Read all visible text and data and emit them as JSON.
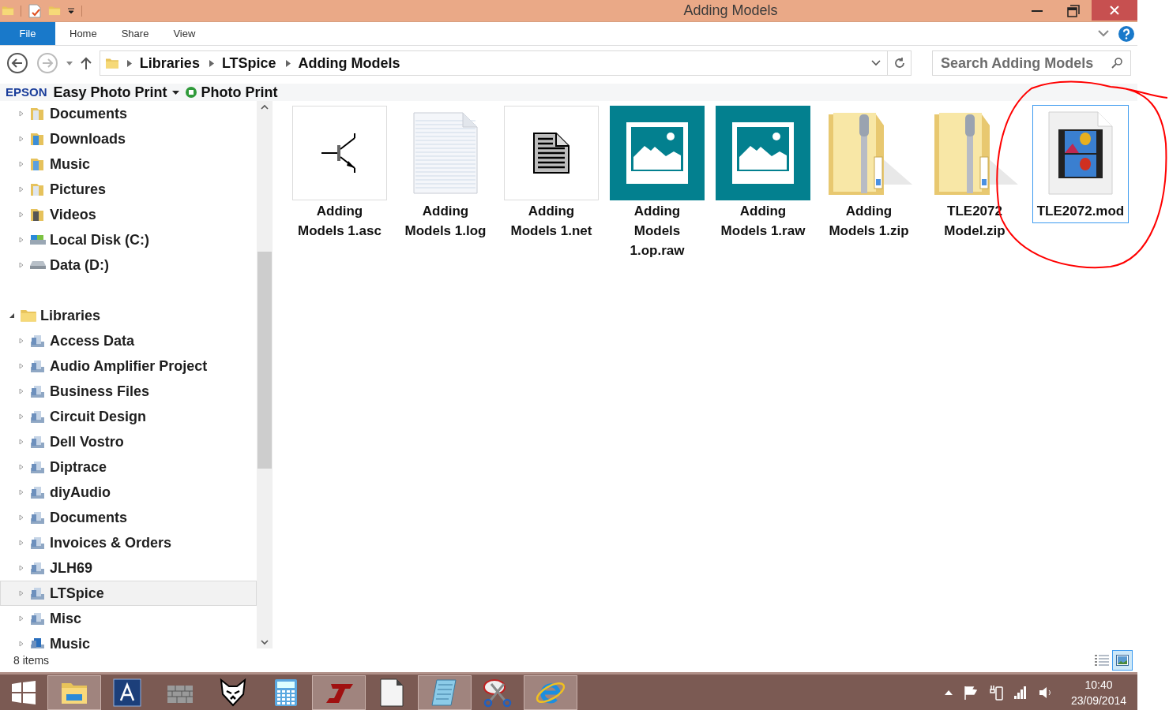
{
  "window": {
    "title": "Adding Models"
  },
  "ribbon": {
    "file_button": "File",
    "tabs": [
      "Home",
      "Share",
      "View"
    ]
  },
  "address": {
    "breadcrumbs": [
      "Libraries",
      "LTSpice",
      "Adding Models"
    ]
  },
  "search": {
    "placeholder": "Search Adding Models"
  },
  "favorites_bar": {
    "brand": "EPSON",
    "items": [
      {
        "label": "Easy Photo Print",
        "kind": "menu"
      },
      {
        "label": "Photo Print",
        "kind": "app"
      }
    ]
  },
  "navigation": {
    "items": [
      {
        "label": "Documents",
        "kind": "documents",
        "selected": false
      },
      {
        "label": "Downloads",
        "kind": "downloads",
        "selected": false
      },
      {
        "label": "Music",
        "kind": "music",
        "selected": false
      },
      {
        "label": "Pictures",
        "kind": "pictures",
        "selected": false
      },
      {
        "label": "Videos",
        "kind": "videos",
        "selected": false
      },
      {
        "label": "Local Disk (C:)",
        "kind": "disk",
        "selected": false
      },
      {
        "label": "Data (D:)",
        "kind": "drive",
        "selected": false
      },
      {
        "label": "Libraries",
        "kind": "libraries",
        "selected": false,
        "expanded": true,
        "children": [
          {
            "label": "Access Data",
            "kind": "library",
            "selected": false
          },
          {
            "label": "Audio Amplifier Project",
            "kind": "library",
            "selected": false
          },
          {
            "label": "Business Files",
            "kind": "library",
            "selected": false
          },
          {
            "label": "Circuit Design",
            "kind": "library",
            "selected": false
          },
          {
            "label": "Dell Vostro",
            "kind": "library",
            "selected": false
          },
          {
            "label": "Diptrace",
            "kind": "library",
            "selected": false
          },
          {
            "label": "diyAudio",
            "kind": "library",
            "selected": false
          },
          {
            "label": "Documents",
            "kind": "doc-library",
            "selected": false
          },
          {
            "label": "Invoices & Orders",
            "kind": "library",
            "selected": false
          },
          {
            "label": "JLH69",
            "kind": "library",
            "selected": false
          },
          {
            "label": "LTSpice",
            "kind": "library",
            "selected": true
          },
          {
            "label": "Misc",
            "kind": "library",
            "selected": false
          },
          {
            "label": "Music",
            "kind": "music-library",
            "selected": false
          }
        ]
      }
    ]
  },
  "files": [
    {
      "name": "Adding Models 1.asc",
      "kind": "schematic",
      "selected": false
    },
    {
      "name": "Adding Models 1.log",
      "kind": "text",
      "selected": false
    },
    {
      "name": "Adding Models 1.net",
      "kind": "netlist",
      "selected": false
    },
    {
      "name": "Adding Models 1.op.raw",
      "kind": "image",
      "selected": false
    },
    {
      "name": "Adding Models 1.raw",
      "kind": "image",
      "selected": false
    },
    {
      "name": "Adding Models 1.zip",
      "kind": "zip",
      "selected": false
    },
    {
      "name": "TLE2072 Model.zip",
      "kind": "zip",
      "selected": false
    },
    {
      "name": "TLE2072.mod",
      "kind": "video",
      "selected": true
    }
  ],
  "status_bar": {
    "count": "8 items",
    "view_buttons": [
      {
        "kind": "details",
        "selected": false
      },
      {
        "kind": "large-icons",
        "selected": true
      }
    ]
  },
  "taskbar": {
    "apps": [
      {
        "kind": "explorer",
        "open": true
      },
      {
        "kind": "letter",
        "open": false
      },
      {
        "kind": "wall",
        "open": false
      },
      {
        "kind": "fox",
        "open": false
      },
      {
        "kind": "calculator",
        "open": false
      },
      {
        "kind": "ltspice",
        "open": true
      },
      {
        "kind": "document",
        "open": false
      },
      {
        "kind": "notepad",
        "open": true
      },
      {
        "kind": "scissors",
        "open": false
      },
      {
        "kind": "browser",
        "open": true
      }
    ],
    "time": "10:40",
    "date": "23/09/2014"
  }
}
